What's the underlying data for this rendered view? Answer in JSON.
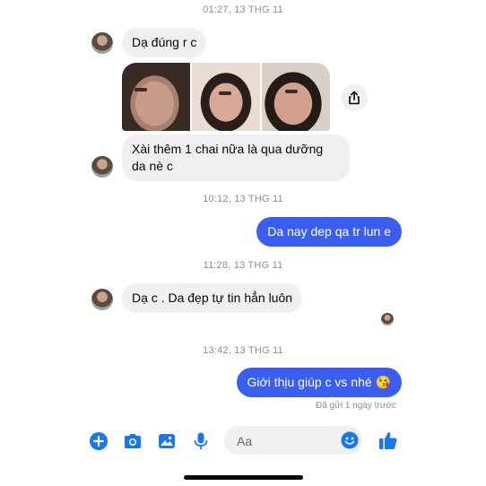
{
  "timestamps": [
    "01:27, 13 THG 11",
    "10:12, 13 THG 11",
    "11:28, 13 THG 11",
    "13:42, 13 THG 11"
  ],
  "messages": {
    "m1": "Dạ đúng r c",
    "m2": "Xài thêm 1 chai nữa là qua dưỡng da nè c",
    "m3": "Da nay dep qa tr lun e",
    "m4": "Dạ c . Da đẹp tự tin hẳn luôn",
    "m5": "Giới thịu giúp c vs nhé 😘"
  },
  "photos": [
    {
      "icon": "face-photo"
    },
    {
      "icon": "face-photo"
    },
    {
      "icon": "face-photo"
    }
  ],
  "status": {
    "sent": "Đã gửi 1 ngày trước"
  },
  "composer": {
    "placeholder": "Aa"
  },
  "colors": {
    "outgoing_bubble": "#3a5ef2",
    "incoming_bubble": "#f0f0f0",
    "accent_icon": "#1877f2"
  },
  "icons": [
    "plus-icon",
    "camera-icon",
    "image-icon",
    "microphone-icon",
    "emoji-icon",
    "thumbs-up-icon",
    "share-icon"
  ]
}
